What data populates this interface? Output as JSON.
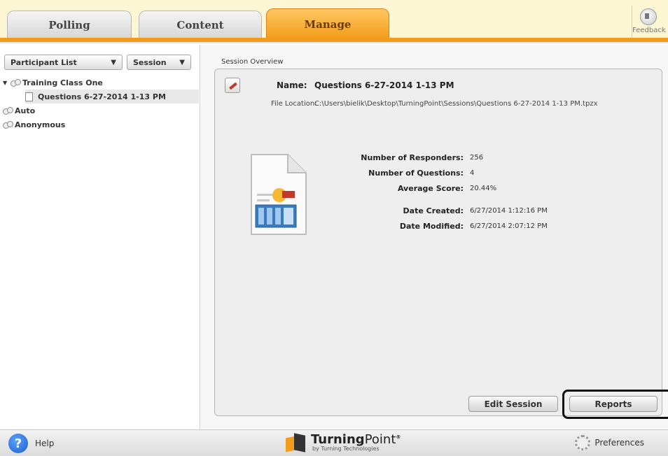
{
  "tabs": {
    "polling": "Polling",
    "content": "Content",
    "manage": "Manage",
    "active": "Manage"
  },
  "feedback": {
    "label": "Feedback",
    "icon": "speaker-icon"
  },
  "left_panel": {
    "participant_dropdown": "Participant List",
    "session_dropdown": "Session",
    "tree": {
      "class": "Training Class One",
      "session": "Questions 6-27-2014 1-13 PM",
      "auto": "Auto",
      "anonymous": "Anonymous"
    }
  },
  "overview": {
    "section_label": "Session Overview",
    "name_label": "Name:",
    "name_value": "Questions 6-27-2014 1-13 PM",
    "file_location_label": "File Location:",
    "file_location_value": "C:\\Users\\bielik\\Desktop\\TurningPoint\\Sessions\\Questions 6-27-2014 1-13 PM.tpzx",
    "stats": {
      "responders_label": "Number of Responders:",
      "responders_value": "256",
      "questions_label": "Number of Questions:",
      "questions_value": "4",
      "avg_label": "Average Score:",
      "avg_value": "20.44%",
      "created_label": "Date Created:",
      "created_value": "6/27/2014 1:12:16 PM",
      "modified_label": "Date Modified:",
      "modified_value": "6/27/2014 2:07:12 PM"
    },
    "edit_button": "Edit Session",
    "reports_button": "Reports"
  },
  "footer": {
    "help": "Help",
    "brand_bold": "Turning",
    "brand_regular": "Point",
    "brand_mark": "®",
    "brand_sub": "by Turning Technologies",
    "preferences": "Preferences"
  },
  "colors": {
    "accent": "#f39b1a",
    "tab_band": "#fdf6d4"
  }
}
